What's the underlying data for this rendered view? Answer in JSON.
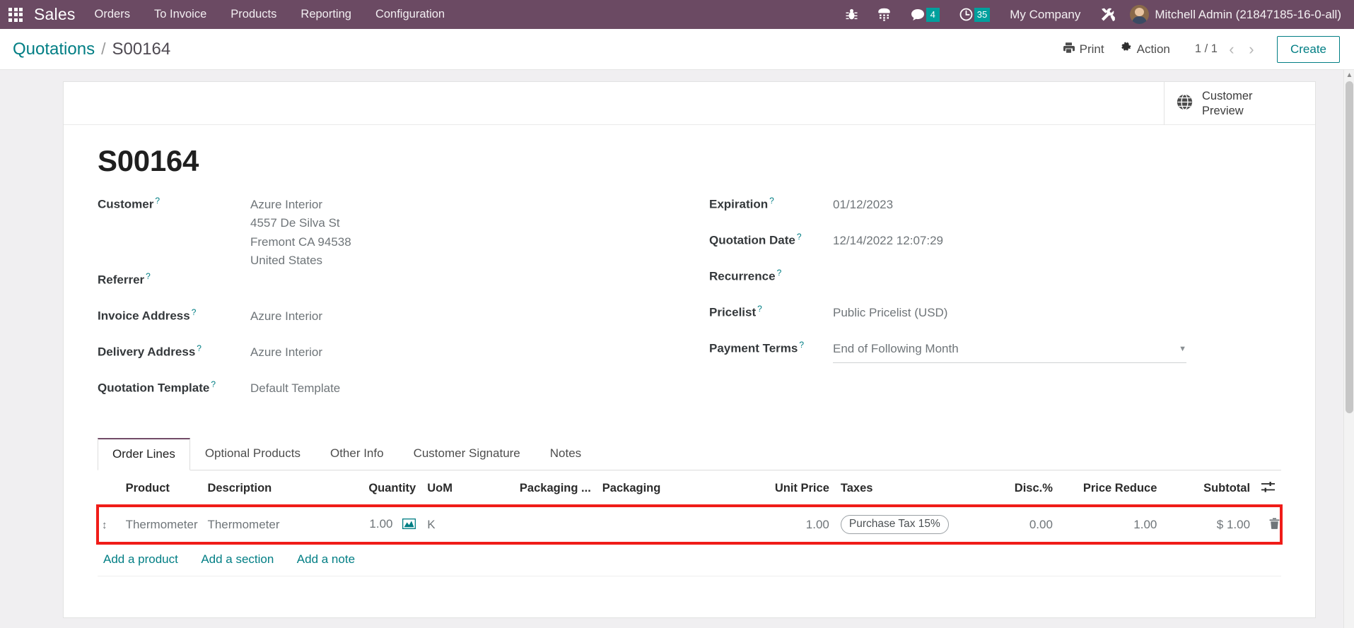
{
  "navbar": {
    "apps_icon": "apps-grid-icon",
    "brand": "Sales",
    "menu": [
      {
        "label": "Orders"
      },
      {
        "label": "To Invoice"
      },
      {
        "label": "Products"
      },
      {
        "label": "Reporting"
      },
      {
        "label": "Configuration"
      }
    ],
    "systray": [
      {
        "icon": "bug-icon",
        "badge": null
      },
      {
        "icon": "dialpad-icon",
        "badge": null
      },
      {
        "icon": "chat-bubble-icon",
        "badge": "4"
      },
      {
        "icon": "clock-icon",
        "badge": "35"
      }
    ],
    "company": "My Company",
    "tools_icon": "tools-icon",
    "user_name": "Mitchell Admin (21847185-16-0-all)",
    "badge_color": "#00A09D",
    "background": "#6b4a63"
  },
  "control_panel": {
    "breadcrumb_root": "Quotations",
    "breadcrumb_separator": "/",
    "breadcrumb_current": "S00164",
    "print_label": "Print",
    "action_label": "Action",
    "pager": "1 / 1",
    "prev_arrow": "‹",
    "next_arrow": "›",
    "create_label": "Create",
    "accent_color": "#017e84"
  },
  "stat_buttons": [
    {
      "icon": "globe-icon",
      "label": "Customer\nPreview"
    }
  ],
  "record": {
    "title": "S00164"
  },
  "form": {
    "left_fields": [
      {
        "label": "Customer",
        "help": "?",
        "value_lines": [
          "Azure Interior",
          "4557 De Silva St",
          "Fremont CA 94538",
          "United States"
        ]
      },
      {
        "label": "Referrer",
        "help": "?",
        "value_lines": []
      },
      {
        "label": "Invoice Address",
        "help": "?",
        "value_lines": [
          "Azure Interior"
        ]
      },
      {
        "label": "Delivery Address",
        "help": "?",
        "value_lines": [
          "Azure Interior"
        ]
      },
      {
        "label": "Quotation Template",
        "help": "?",
        "value_lines": [
          "Default Template"
        ]
      }
    ],
    "right_fields": [
      {
        "label": "Expiration",
        "help": "?",
        "value": "01/12/2023",
        "type": "text"
      },
      {
        "label": "Quotation Date",
        "help": "?",
        "value": "12/14/2022 12:07:29",
        "type": "text"
      },
      {
        "label": "Recurrence",
        "help": "?",
        "value": "",
        "type": "text"
      },
      {
        "label": "Pricelist",
        "help": "?",
        "value": "Public Pricelist (USD)",
        "type": "text"
      },
      {
        "label": "Payment Terms",
        "help": "?",
        "value": "End of Following Month",
        "type": "dropdown",
        "caret": "▼"
      }
    ]
  },
  "notebook": {
    "tabs": [
      {
        "label": "Order Lines",
        "active": true
      },
      {
        "label": "Optional Products",
        "active": false
      },
      {
        "label": "Other Info",
        "active": false
      },
      {
        "label": "Customer Signature",
        "active": false
      },
      {
        "label": "Notes",
        "active": false
      }
    ]
  },
  "order_lines": {
    "columns": [
      "Product",
      "Description",
      "Quantity",
      "UoM",
      "Packaging ...",
      "Packaging",
      "Unit Price",
      "Taxes",
      "Disc.%",
      "Price Reduce",
      "Subtotal"
    ],
    "settings_icon": "column-settings-icon",
    "rows": [
      {
        "handle": "↕",
        "product": "Thermometer",
        "description": "Thermometer",
        "quantity": "1.00",
        "quantity_icon": "forecast-chart-icon",
        "uom": "K",
        "packaging_qty": "",
        "packaging": "",
        "unit_price": "1.00",
        "taxes": "Purchase Tax 15%",
        "discount": "0.00",
        "price_reduce": "1.00",
        "subtotal": "$ 1.00",
        "delete_icon": "trash-icon",
        "highlighted": true,
        "highlight_color": "#f01c18"
      }
    ],
    "add_links": [
      {
        "label": "Add a product"
      },
      {
        "label": "Add a section"
      },
      {
        "label": "Add a note"
      }
    ]
  }
}
